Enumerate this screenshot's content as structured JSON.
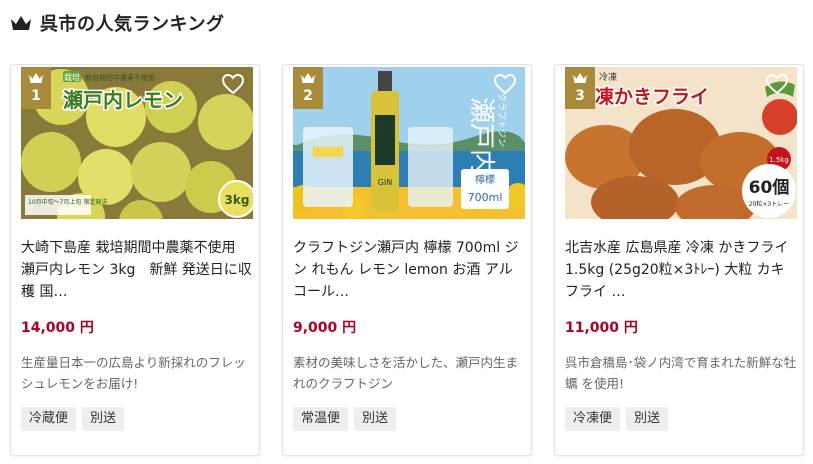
{
  "header": {
    "title": "呉市の人気ランキング",
    "icon": "crown-icon"
  },
  "colors": {
    "rank_badge": "#a88a3a",
    "price": "#b00020",
    "tag_bg": "#eeeeee"
  },
  "cards": [
    {
      "rank": "1",
      "image_text": {
        "main": "瀬戸内レモン",
        "tag": "栽培",
        "sub": "栽培期間中農薬不使用",
        "size": "3kg",
        "note": "10月中旬〜7月上旬 限定発送"
      },
      "name": "大崎下島産 栽培期間中農薬不使用 瀬戸内レモン 3kg　新鮮 発送日に収穫 国…",
      "price": "14,000 円",
      "description": "生産量日本一の広島より新採れのフレッシュレモンをお届け!",
      "tags": [
        "冷蔵便",
        "別送"
      ]
    },
    {
      "rank": "2",
      "image_text": {
        "main": "瀬戸内",
        "sub": "クラフトジン",
        "label": "檸檬",
        "volume": "700ml",
        "bottle": "GIN"
      },
      "name": "クラフトジン瀬戸内 檸檬 700ml ジン れもん レモン lemon お酒 アルコール…",
      "price": "9,000 円",
      "description": "素材の美味しさを活かした、瀬戸内生まれのクラフトジン",
      "tags": [
        "常温便",
        "別送"
      ]
    },
    {
      "rank": "3",
      "image_text": {
        "main": "凍かきフライ",
        "top": "冷凍",
        "weight": "1.5kg",
        "count": "60個",
        "count_note": "20粒×3トレー"
      },
      "name": "北吉水産 広島県産 冷凍 かきフライ 1.5kg (25g20粒×3ﾄﾚｰ) 大粒 カキフライ …",
      "price": "11,000 円",
      "description": "呉市倉橋島･袋ノ内湾で育まれた新鮮な牡蠣 を使用!",
      "tags": [
        "冷凍便",
        "別送"
      ]
    }
  ]
}
